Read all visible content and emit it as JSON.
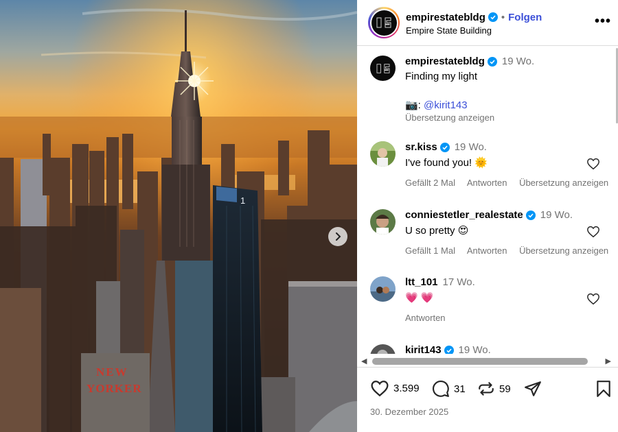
{
  "post": {
    "username": "empirestatebldg",
    "follow_label": "Folgen",
    "separator": "•",
    "subtitle": "Empire State Building",
    "more_label": "•••",
    "caption_time": "19 Wo.",
    "caption_line1": "Finding my light",
    "caption_credit_prefix": "📷: ",
    "caption_credit_handle": "@kirit143",
    "caption_translate": "Übersetzung anzeigen",
    "sign_text_1": "NEW",
    "sign_text_2": "YORKER",
    "building_number": "1"
  },
  "comments": [
    {
      "user": "sr.kiss",
      "time": "19 Wo.",
      "text": "I've found you! ",
      "emoji": "🌞",
      "likes": "Gefällt 2 Mal",
      "reply": "Antworten",
      "translate": "Übersetzung anzeigen"
    },
    {
      "user": "conniestetler_realestate",
      "time": "19 Wo.",
      "text": "U so pretty ",
      "emoji": "😍",
      "likes": "Gefällt 1 Mal",
      "reply": "Antworten",
      "translate": "Übersetzung anzeigen"
    },
    {
      "user": "ltt_101",
      "time": "17 Wo.",
      "text": "",
      "emoji": "💗 💗",
      "reply": "Antworten"
    },
    {
      "user": "kirit143",
      "time": "19 Wo."
    }
  ],
  "stats": {
    "likes": "3.599",
    "comments": "31",
    "reposts": "59"
  },
  "date": "30. Dezember 2025",
  "scroll": {
    "left": "◀",
    "right": "▶"
  },
  "colors": {
    "link": "#3b4fd8",
    "verified": "#0095f6",
    "secondary": "#737373"
  }
}
